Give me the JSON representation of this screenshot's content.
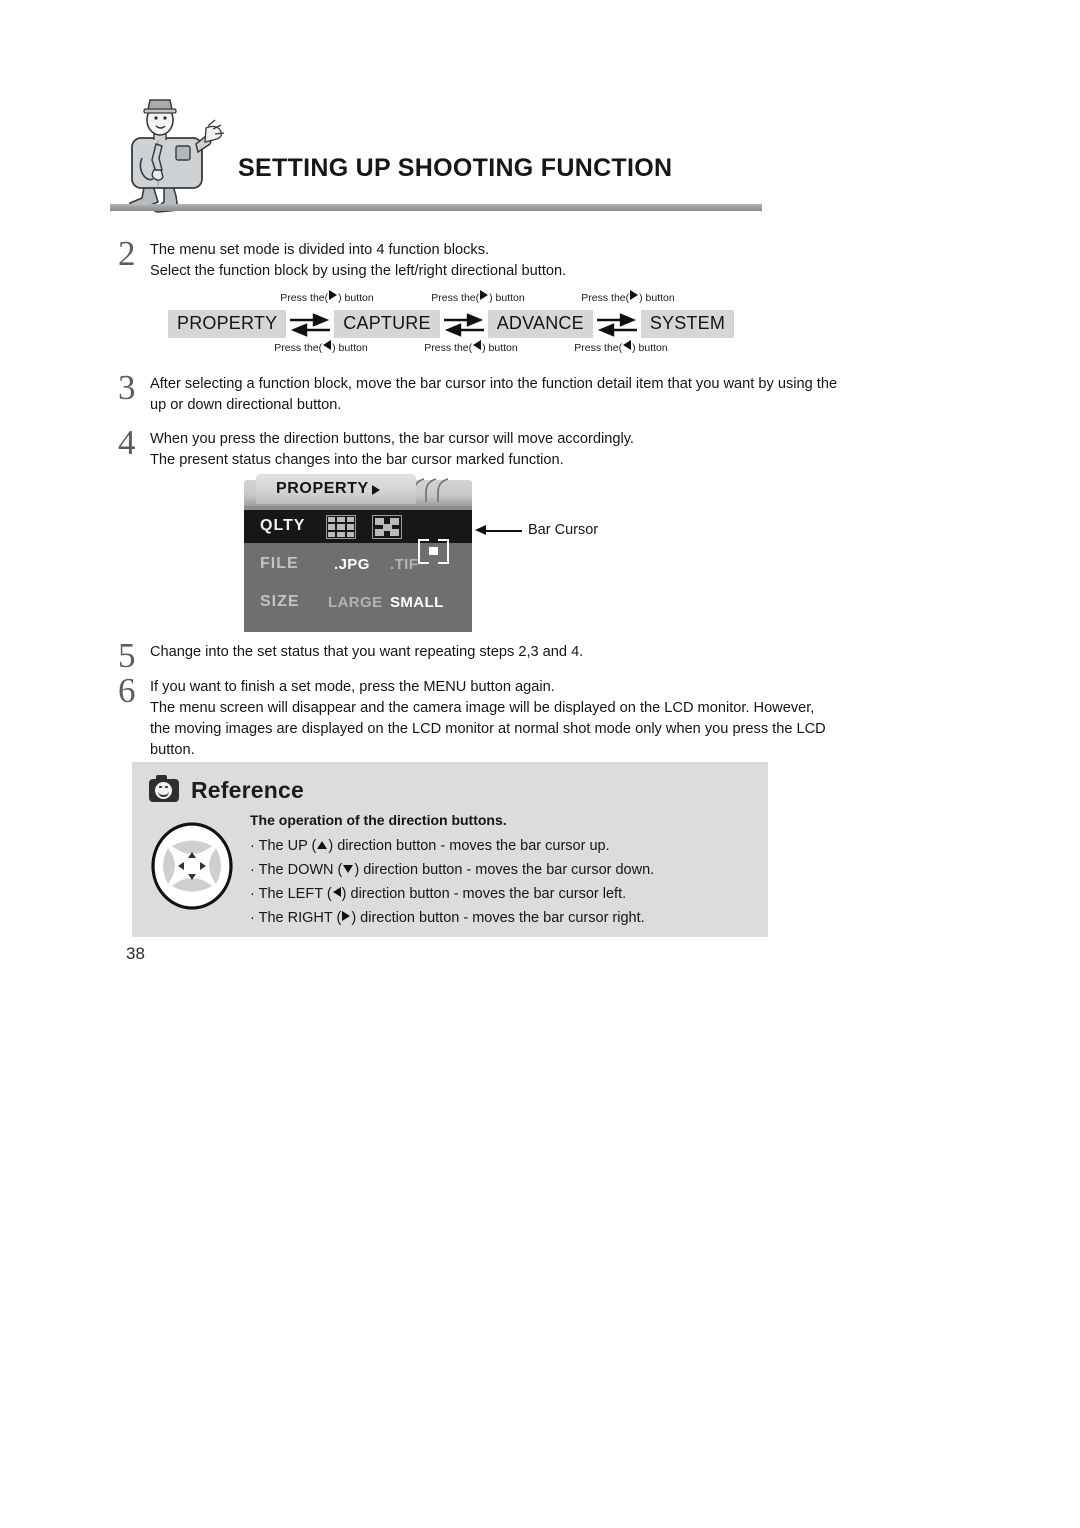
{
  "header": {
    "title": "SETTING UP SHOOTING FUNCTION",
    "mascot_icon": "camera-mascot-illustration"
  },
  "steps": {
    "step2": {
      "number": "2",
      "lines": [
        "The menu set mode is divided into 4 function blocks.",
        "Select the function block by using the left/right directional button."
      ]
    },
    "step3": {
      "number": "3",
      "lines": [
        "After selecting a function block, move the bar cursor into the function detail item that you want by using the",
        "up or down directional button."
      ]
    },
    "step4": {
      "number": "4",
      "lines": [
        "When you press the direction buttons, the bar cursor will move accordingly.",
        "The present status changes into the bar cursor marked function."
      ]
    },
    "step5": {
      "number": "5",
      "lines": [
        "Change into the set status that you want repeating steps 2,3 and 4."
      ]
    },
    "step6": {
      "number": "6",
      "lines": [
        "If you want to finish a set mode, press the MENU button again.",
        "The menu screen will disappear and the camera image will be displayed on the LCD monitor. However,",
        "the moving images are displayed on the LCD monitor at normal shot mode only when you press the LCD",
        "button."
      ]
    }
  },
  "block_diagram": {
    "blocks": [
      {
        "label": "PROPERTY"
      },
      {
        "label": "CAPTURE"
      },
      {
        "label": "ADVANCE"
      },
      {
        "label": "SYSTEM"
      }
    ],
    "arrows": [
      {
        "caption_top": "Press the(  ) button",
        "caption_bottom": "Press the(  ) button"
      },
      {
        "caption_top": "Press the(  ) button",
        "caption_bottom": "Press the(  ) button"
      },
      {
        "caption_top": "Press the(  ) button",
        "caption_bottom": "Press the(  ) button"
      }
    ],
    "caption_prefix": "Press the(",
    "caption_suffix": ") button"
  },
  "lcd_menu": {
    "tab_label": "PROPERTY",
    "rows": [
      {
        "label": "QLTY",
        "selected_row": true,
        "options": [
          {
            "icon": "quality-super-fine-grid-icon",
            "selected": false
          },
          {
            "icon": "quality-fine-checker-icon",
            "selected": false
          },
          {
            "icon": "quality-normal-frame-icon",
            "selected": true
          }
        ]
      },
      {
        "label": "FILE",
        "selected_row": false,
        "options": [
          {
            "label": ".JPG",
            "selected": true
          },
          {
            "label": ".TIF",
            "selected": false
          }
        ]
      },
      {
        "label": "SIZE",
        "selected_row": false,
        "options": [
          {
            "label": "LARGE",
            "selected": false
          },
          {
            "label": "SMALL",
            "selected": true
          }
        ]
      }
    ]
  },
  "callout": {
    "label": "Bar Cursor"
  },
  "reference": {
    "title": "Reference",
    "icon": "camera-smiley-icon",
    "subtitle": "The operation of the direction buttons.",
    "dpad_icon": "direction-pad-icon",
    "items": [
      {
        "prefix": "· The UP (",
        "arrow": "up",
        "suffix": ") direction button - moves the bar cursor up."
      },
      {
        "prefix": "· The DOWN (",
        "arrow": "down",
        "suffix": ") direction button - moves the bar cursor down."
      },
      {
        "prefix": "· The LEFT (",
        "arrow": "left",
        "suffix": ") direction button - moves the bar cursor left."
      },
      {
        "prefix": "· The RIGHT (",
        "arrow": "right",
        "suffix": ") direction button - moves the bar cursor right."
      }
    ]
  },
  "page_number": "38",
  "colors": {
    "block_bg": "#d6d6d6",
    "lcd_body": "#6f6f6f",
    "lcd_cursor": "#171717",
    "reference_bg": "#dcdcdc",
    "rule": "#9aa0a3"
  }
}
